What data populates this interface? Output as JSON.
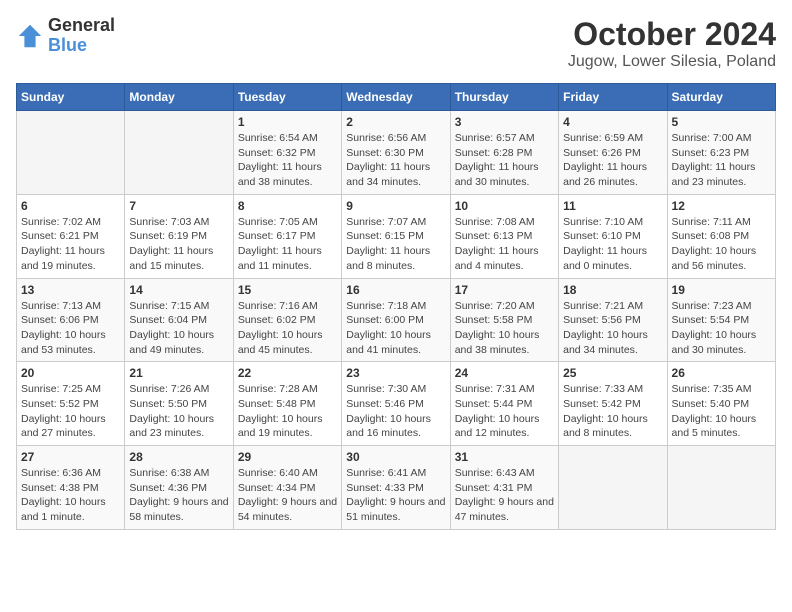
{
  "logo": {
    "line1": "General",
    "line2": "Blue"
  },
  "title": "October 2024",
  "subtitle": "Jugow, Lower Silesia, Poland",
  "days_of_week": [
    "Sunday",
    "Monday",
    "Tuesday",
    "Wednesday",
    "Thursday",
    "Friday",
    "Saturday"
  ],
  "weeks": [
    [
      {
        "day": "",
        "info": ""
      },
      {
        "day": "",
        "info": ""
      },
      {
        "day": "1",
        "info": "Sunrise: 6:54 AM\nSunset: 6:32 PM\nDaylight: 11 hours and 38 minutes."
      },
      {
        "day": "2",
        "info": "Sunrise: 6:56 AM\nSunset: 6:30 PM\nDaylight: 11 hours and 34 minutes."
      },
      {
        "day": "3",
        "info": "Sunrise: 6:57 AM\nSunset: 6:28 PM\nDaylight: 11 hours and 30 minutes."
      },
      {
        "day": "4",
        "info": "Sunrise: 6:59 AM\nSunset: 6:26 PM\nDaylight: 11 hours and 26 minutes."
      },
      {
        "day": "5",
        "info": "Sunrise: 7:00 AM\nSunset: 6:23 PM\nDaylight: 11 hours and 23 minutes."
      }
    ],
    [
      {
        "day": "6",
        "info": "Sunrise: 7:02 AM\nSunset: 6:21 PM\nDaylight: 11 hours and 19 minutes."
      },
      {
        "day": "7",
        "info": "Sunrise: 7:03 AM\nSunset: 6:19 PM\nDaylight: 11 hours and 15 minutes."
      },
      {
        "day": "8",
        "info": "Sunrise: 7:05 AM\nSunset: 6:17 PM\nDaylight: 11 hours and 11 minutes."
      },
      {
        "day": "9",
        "info": "Sunrise: 7:07 AM\nSunset: 6:15 PM\nDaylight: 11 hours and 8 minutes."
      },
      {
        "day": "10",
        "info": "Sunrise: 7:08 AM\nSunset: 6:13 PM\nDaylight: 11 hours and 4 minutes."
      },
      {
        "day": "11",
        "info": "Sunrise: 7:10 AM\nSunset: 6:10 PM\nDaylight: 11 hours and 0 minutes."
      },
      {
        "day": "12",
        "info": "Sunrise: 7:11 AM\nSunset: 6:08 PM\nDaylight: 10 hours and 56 minutes."
      }
    ],
    [
      {
        "day": "13",
        "info": "Sunrise: 7:13 AM\nSunset: 6:06 PM\nDaylight: 10 hours and 53 minutes."
      },
      {
        "day": "14",
        "info": "Sunrise: 7:15 AM\nSunset: 6:04 PM\nDaylight: 10 hours and 49 minutes."
      },
      {
        "day": "15",
        "info": "Sunrise: 7:16 AM\nSunset: 6:02 PM\nDaylight: 10 hours and 45 minutes."
      },
      {
        "day": "16",
        "info": "Sunrise: 7:18 AM\nSunset: 6:00 PM\nDaylight: 10 hours and 41 minutes."
      },
      {
        "day": "17",
        "info": "Sunrise: 7:20 AM\nSunset: 5:58 PM\nDaylight: 10 hours and 38 minutes."
      },
      {
        "day": "18",
        "info": "Sunrise: 7:21 AM\nSunset: 5:56 PM\nDaylight: 10 hours and 34 minutes."
      },
      {
        "day": "19",
        "info": "Sunrise: 7:23 AM\nSunset: 5:54 PM\nDaylight: 10 hours and 30 minutes."
      }
    ],
    [
      {
        "day": "20",
        "info": "Sunrise: 7:25 AM\nSunset: 5:52 PM\nDaylight: 10 hours and 27 minutes."
      },
      {
        "day": "21",
        "info": "Sunrise: 7:26 AM\nSunset: 5:50 PM\nDaylight: 10 hours and 23 minutes."
      },
      {
        "day": "22",
        "info": "Sunrise: 7:28 AM\nSunset: 5:48 PM\nDaylight: 10 hours and 19 minutes."
      },
      {
        "day": "23",
        "info": "Sunrise: 7:30 AM\nSunset: 5:46 PM\nDaylight: 10 hours and 16 minutes."
      },
      {
        "day": "24",
        "info": "Sunrise: 7:31 AM\nSunset: 5:44 PM\nDaylight: 10 hours and 12 minutes."
      },
      {
        "day": "25",
        "info": "Sunrise: 7:33 AM\nSunset: 5:42 PM\nDaylight: 10 hours and 8 minutes."
      },
      {
        "day": "26",
        "info": "Sunrise: 7:35 AM\nSunset: 5:40 PM\nDaylight: 10 hours and 5 minutes."
      }
    ],
    [
      {
        "day": "27",
        "info": "Sunrise: 6:36 AM\nSunset: 4:38 PM\nDaylight: 10 hours and 1 minute."
      },
      {
        "day": "28",
        "info": "Sunrise: 6:38 AM\nSunset: 4:36 PM\nDaylight: 9 hours and 58 minutes."
      },
      {
        "day": "29",
        "info": "Sunrise: 6:40 AM\nSunset: 4:34 PM\nDaylight: 9 hours and 54 minutes."
      },
      {
        "day": "30",
        "info": "Sunrise: 6:41 AM\nSunset: 4:33 PM\nDaylight: 9 hours and 51 minutes."
      },
      {
        "day": "31",
        "info": "Sunrise: 6:43 AM\nSunset: 4:31 PM\nDaylight: 9 hours and 47 minutes."
      },
      {
        "day": "",
        "info": ""
      },
      {
        "day": "",
        "info": ""
      }
    ]
  ]
}
